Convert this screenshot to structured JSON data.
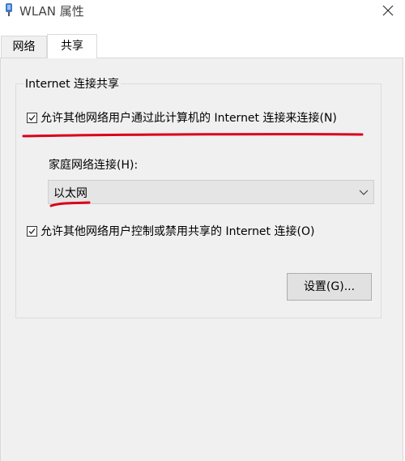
{
  "window": {
    "title": "WLAN 属性",
    "icon": "wifi-adapter-icon",
    "close_icon": "close-icon"
  },
  "tabs": [
    {
      "label": "网络",
      "selected": false
    },
    {
      "label": "共享",
      "selected": true
    }
  ],
  "sharing": {
    "group_title": "Internet 连接共享",
    "allow_share": {
      "label": "允许其他网络用户通过此计算机的 Internet 连接来连接(N)",
      "checked": true
    },
    "home_network": {
      "label": "家庭网络连接(H):",
      "selected_value": "以太网"
    },
    "allow_control": {
      "label": "允许其他网络用户控制或禁用共享的 Internet 连接(O)",
      "checked": true
    },
    "settings_button": "设置(G)..."
  },
  "colors": {
    "annotation_red": "#d9001b",
    "panel_bg": "#f0f0f0",
    "button_bg": "#e1e1e1"
  }
}
